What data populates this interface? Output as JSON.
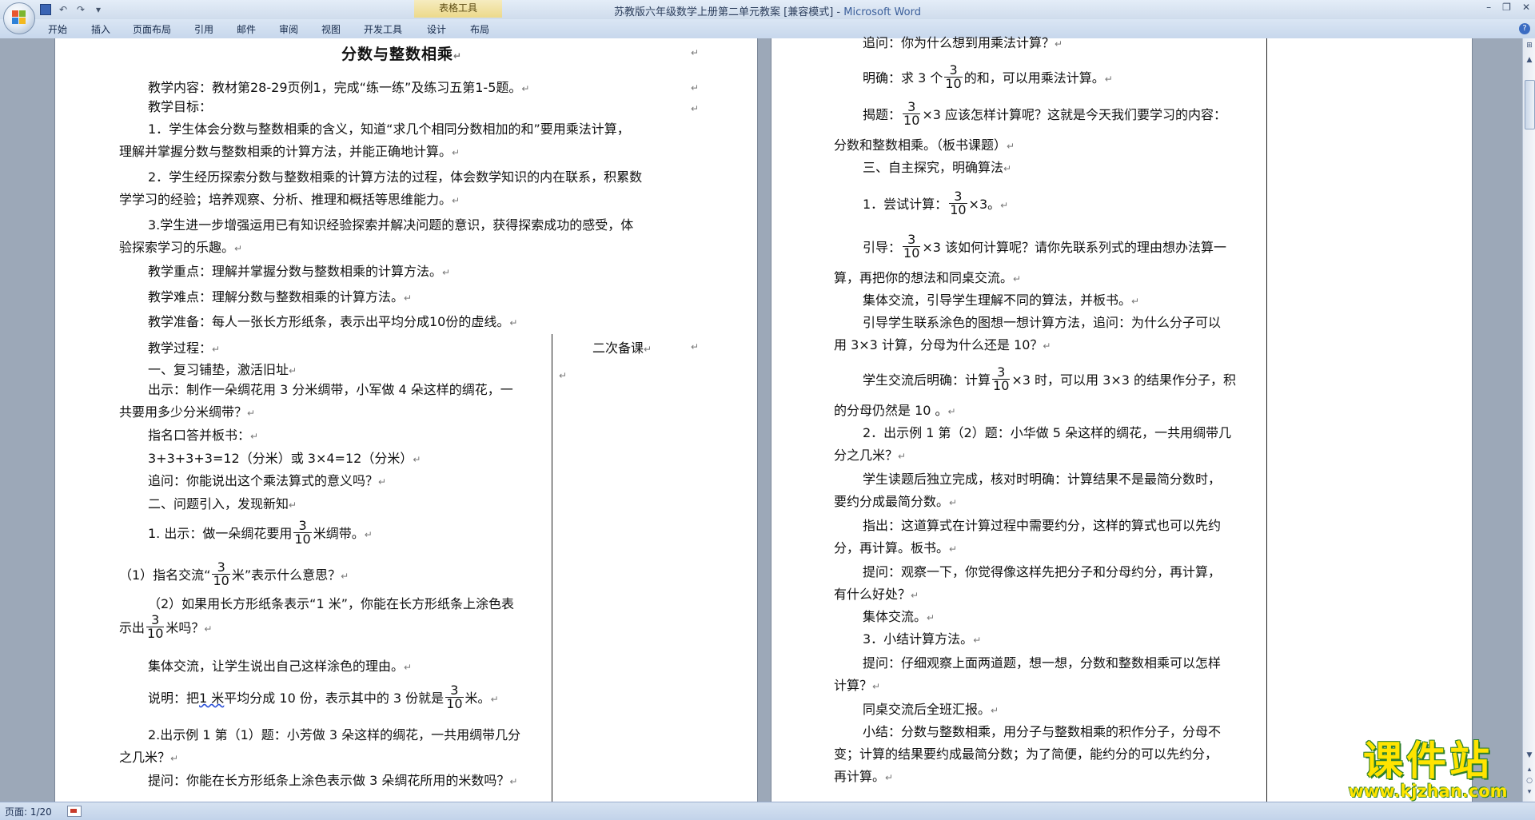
{
  "window": {
    "title": "苏教版六年级数学上册第二单元教案 [兼容模式] - ",
    "app_name": "Microsoft Word",
    "controls": [
      "–",
      "❐",
      "✕"
    ]
  },
  "ribbon": {
    "contextual_label": "表格工具",
    "tabs": [
      "开始",
      "插入",
      "页面布局",
      "引用",
      "邮件",
      "审阅",
      "视图",
      "开发工具",
      "设计",
      "布局"
    ]
  },
  "page1": {
    "title": "分数与整数相乘",
    "para_content": "教学内容：教材第28-29页例1，完成“练一练”及练习五第1-5题。",
    "para_objective": "教学目标：",
    "obj1_line1": "1．学生体会分数与整数相乘的含义，知道“求几个相同分数相加的和”要用乘法计算，",
    "obj1_line2": "理解并掌握分数与整数相乘的计算方法，并能正确地计算。",
    "obj2_line1": "2．学生经历探索分数与整数相乘的计算方法的过程，体会数学知识的内在联系，积累数",
    "obj2_line2": "学学习的经验；培养观察、分析、推理和概括等思维能力。",
    "obj3_line1": "3.学生进一步增强运用已有知识经验探索并解决问题的意识，获得探索成功的感受，体",
    "obj3_line2": "验探索学习的乐趣。",
    "key_point": "教学重点：理解并掌握分数与整数相乘的计算方法。",
    "difficulty": "教学难点：理解分数与整数相乘的计算方法。",
    "preparation": "教学准备：每人一张长方形纸条，表示出平均分成10份的虚线。",
    "process": "教学过程：",
    "side_header": "二次备课",
    "s1_title": "一、复习铺垫，激活旧址",
    "s1_show_line1": "出示：制作一朵绸花用 3 分米绸带，小军做 4 朵这样的绸花，一",
    "s1_show_line2": "共要用多少分米绸带？",
    "s1_answer": "指名口答并板书：",
    "s1_formula": "3+3+3+3=12（分米）或 3×4=12（分米）",
    "s1_ask": "追问：你能说出这个乘法算式的意义吗？",
    "s2_title": "二、问题引入，发现新知",
    "s2_q1_pre": "1. 出示：做一朵绸花要用",
    "s2_q1_post": "米绸带。",
    "s2_q1a_pre": "（1）指名交流“",
    "s2_q1a_post": "米”表示什么意思？",
    "s2_q1b_line1": "（2）如果用长方形纸条表示“1 米”，你能在长方形纸条上涂色表",
    "s2_q1b_pre": "示出",
    "s2_q1b_post": "米吗？",
    "s2_exchange": "集体交流，让学生说出自己这样涂色的理由。",
    "s2_explain_pre": "说明：把",
    "s2_explain_underline": "1 米",
    "s2_explain_mid": "平均分成 10 份，表示其中的 3 份就是",
    "s2_explain_post": "米。",
    "s2_q2_line1": "2.出示例 1 第（1）题：小芳做 3 朵这样的绸花，一共用绸带几分",
    "s2_q2_line2": "之几米？",
    "s2_ask": "提问：你能在长方形纸条上涂色表示做 3 朵绸花所用的米数吗？"
  },
  "page2": {
    "l1": "追问：你为什么想到用乘法计算？",
    "l2_pre": "明确：求 3 个",
    "l2_post": "的和，可以用乘法计算。",
    "l3_post": "×3 应该怎样计算呢？这就是今天我们要学习的内容：",
    "l3_pre": "揭题：",
    "l3b": "分数和整数相乘。（板书课题）",
    "l4": "三、自主探究，明确算法",
    "l5_pre": "1．尝试计算：",
    "l5_post": "×3。",
    "l6_pre": "引导：",
    "l6_post": "×3 该如何计算呢？请你先联系列式的理由想办法算一",
    "l6b": "算，再把你的想法和同桌交流。",
    "l7": "集体交流，引导学生理解不同的算法，并板书。",
    "l8_line1": "引导学生联系涂色的图想一想计算方法，追问：为什么分子可以",
    "l8_line2": "用 3×3 计算，分母为什么还是 10？",
    "l9_pre": "学生交流后明确：计算",
    "l9_post": "×3 时，可以用 3×3 的结果作分子，积",
    "l9b": "的分母仍然是 10 。",
    "l10_line1": "2．出示例 1 第（2）题：小华做 5 朵这样的绸花，一共用绸带几",
    "l10_line2": "分之几米？",
    "l11_line1": "学生读题后独立完成，核对时明确：计算结果不是最简分数时，",
    "l11_line2": "要约分成最简分数。",
    "l12_line1": "指出：这道算式在计算过程中需要约分，这样的算式也可以先约",
    "l12_line2": "分，再计算。板书。",
    "l13_line1": "提问：观察一下，你觉得像这样先把分子和分母约分，再计算，",
    "l13_line2": "有什么好处？",
    "l14": "集体交流。",
    "l15": "3．小结计算方法。",
    "l16_line1": "提问：仔细观察上面两道题，想一想，分数和整数相乘可以怎样",
    "l16_line2": "计算？",
    "l17": "同桌交流后全班汇报。",
    "l18_line1": "小结：分数与整数相乘，用分子与整数相乘的积作分子，分母不",
    "l18_line2": "变；计算的结果要约成最简分数；为了简便，能约分的可以先约分，",
    "l18_line3": "再计算。"
  },
  "fraction": {
    "numerator": "3",
    "denominator": "10"
  },
  "marks": {
    "para": "↵",
    "cell_end": "↵"
  },
  "statusbar": {
    "page_info": "页面: 1/20"
  },
  "watermark": {
    "brand": "课件站",
    "url": "www.kjzhan.com"
  },
  "colors": {
    "watermark_fill": "#ffe400",
    "watermark_outline": "#2c7f2a",
    "ribbon_context": "#ecd98a"
  }
}
